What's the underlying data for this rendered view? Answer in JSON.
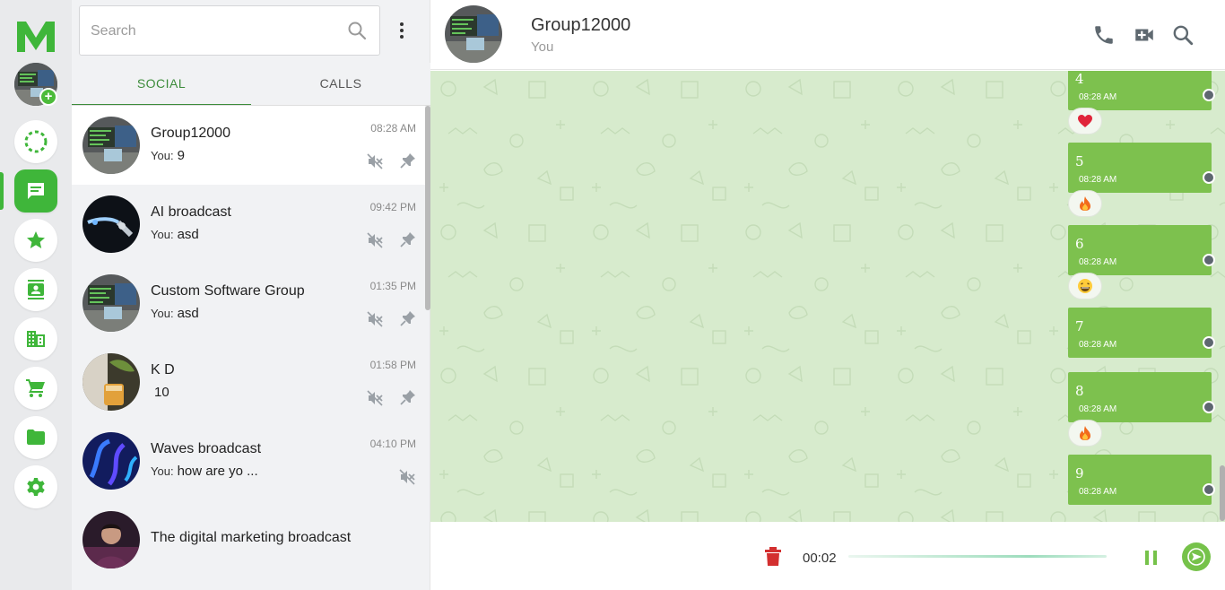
{
  "rail": {
    "logo_text": "M",
    "items": [
      {
        "icon": "status-icon"
      },
      {
        "icon": "chat-icon",
        "active": true
      },
      {
        "icon": "star-icon"
      },
      {
        "icon": "contacts-icon"
      },
      {
        "icon": "building-icon"
      },
      {
        "icon": "cart-icon"
      },
      {
        "icon": "folder-icon"
      },
      {
        "icon": "settings-icon"
      }
    ]
  },
  "search": {
    "placeholder": "Search",
    "value": ""
  },
  "tabs": [
    {
      "label": "SOCIAL",
      "active": true
    },
    {
      "label": "CALLS",
      "active": false
    }
  ],
  "chats": [
    {
      "name": "Group12000",
      "you": "You:",
      "preview": "9",
      "time": "08:28 AM",
      "muted": true,
      "pinned": true,
      "selected": true
    },
    {
      "name": "AI broadcast",
      "you": "You:",
      "preview": "asd",
      "time": "09:42 PM",
      "muted": true,
      "pinned": true
    },
    {
      "name": "Custom Software Group",
      "you": "You:",
      "preview": "asd",
      "time": "01:35 PM",
      "muted": true,
      "pinned": true
    },
    {
      "name": "K D",
      "you": "",
      "preview": "10",
      "time": "01:58 PM",
      "muted": true,
      "pinned": true
    },
    {
      "name": "Waves broadcast",
      "you": "You:",
      "preview": "how are yo ...",
      "time": "04:10 PM",
      "muted": true,
      "pinned": false
    },
    {
      "name": "The digital marketing broadcast",
      "you": "",
      "preview": "",
      "time": "",
      "muted": false,
      "pinned": false
    }
  ],
  "conversation": {
    "title": "Group12000",
    "subtitle": "You",
    "messages": [
      {
        "text": "4",
        "time": "08:28 AM",
        "reaction": "heart"
      },
      {
        "text": "5",
        "time": "08:28 AM",
        "reaction": "fire"
      },
      {
        "text": "6",
        "time": "08:28 AM",
        "reaction": "laugh"
      },
      {
        "text": "7",
        "time": "08:28 AM",
        "reaction": ""
      },
      {
        "text": "8",
        "time": "08:28 AM",
        "reaction": "fire"
      },
      {
        "text": "9",
        "time": "08:28 AM",
        "reaction": ""
      }
    ]
  },
  "composer": {
    "recording_time": "00:02"
  },
  "colors": {
    "brand": "#3fb63a",
    "bubble": "#7dc14e",
    "chat_bg": "#d7ebcd",
    "tab_active": "#3d8c3b"
  }
}
